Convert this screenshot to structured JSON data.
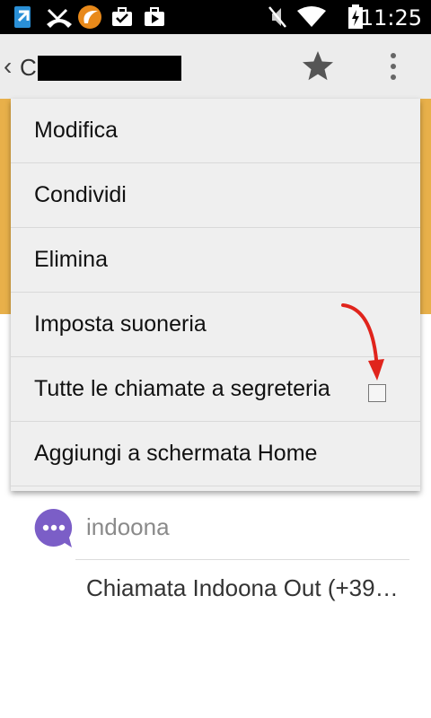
{
  "status_bar": {
    "time": "11:25",
    "icons": [
      "sim-download-icon",
      "missed-call-icon",
      "app-logo-icon",
      "briefcase-check-icon",
      "briefcase-play-icon",
      "mute-icon",
      "wifi-icon",
      "battery-charging-icon"
    ]
  },
  "action_bar": {
    "title": "C",
    "icons": [
      "back-chevron-icon",
      "star-icon",
      "overflow-menu-icon"
    ]
  },
  "menu": {
    "items": [
      {
        "label": "Modifica"
      },
      {
        "label": "Condividi"
      },
      {
        "label": "Elimina"
      },
      {
        "label": "Imposta suoneria"
      },
      {
        "label": "Tutte le chiamate a segreteria",
        "checkbox": false
      },
      {
        "label": "Aggiungi a schermata Home"
      }
    ]
  },
  "entry": {
    "app": "indoona",
    "detail": "Chiamata Indoona Out (+39…"
  },
  "colors": {
    "header": "#e8b04a",
    "accent": "#7b5ec7",
    "arrow": "#e0241c"
  }
}
